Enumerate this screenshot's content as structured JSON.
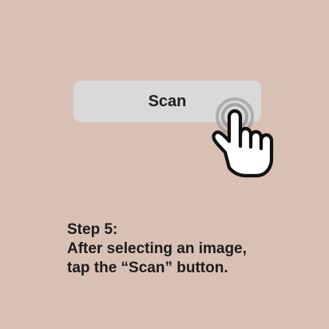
{
  "colors": {
    "background": "#d8c1b4",
    "button_fill": "#d9d9d9",
    "button_text": "#1f1f1f",
    "text": "#1b1b1b",
    "hand_outline": "#111111",
    "hand_fill": "#ffffff",
    "ripple": "#9a9a9a"
  },
  "button": {
    "label": "Scan"
  },
  "icons": {
    "pointer": "hand-tap-icon",
    "ripple": "tap-ripple-icon"
  },
  "instructions": {
    "step": "Step 5:",
    "line_1": "After selecting an image,",
    "line_2": "tap the “Scan” button."
  }
}
